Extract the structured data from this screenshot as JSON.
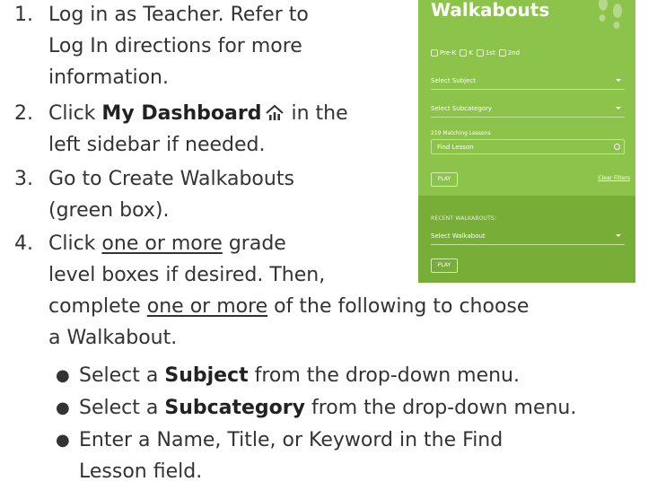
{
  "instructions": {
    "step1": {
      "number": "1.",
      "line1": "Log in as Teacher. Refer to",
      "line2": "Log In directions for more",
      "line3": "information."
    },
    "step2": {
      "number": "2.",
      "pre": "Click ",
      "bold": "My Dashboard",
      "post": " in the",
      "line2": "left sidebar if needed."
    },
    "step3": {
      "number": "3.",
      "line1": "Go to Create Walkabouts",
      "line2": "(green box)."
    },
    "step4": {
      "number": "4.",
      "l1_pre": "Click ",
      "l1_u": "one or more",
      "l1_post": " grade",
      "line2": "level boxes if desired. Then,",
      "l3_pre": "complete ",
      "l3_u": "one or more",
      "l3_post": " of the following to choose",
      "line4": "a Walkabout."
    },
    "bullets": [
      {
        "pre": "Select a ",
        "bold": "Subject",
        "post": " from the drop-down menu."
      },
      {
        "pre": "Select a ",
        "bold": "Subcategory",
        "post": " from the drop-down menu."
      },
      {
        "line1": "Enter a Name, Title, or Keyword in the Find",
        "line2": "Lesson field."
      }
    ]
  },
  "panel": {
    "title": "Walkabouts",
    "grades": [
      "Pre-K",
      "K",
      "1st",
      "2nd"
    ],
    "subject_select": "Select Subject",
    "subcategory_select": "Select Subcategory",
    "matching_count": "219 Matching Lessons",
    "find_placeholder": "Find Lesson",
    "play_label": "PLAY",
    "clear_filters": "Clear Filters",
    "recent_title": "RECENT WALKABOUTS:",
    "walkabout_select": "Select Walkabout",
    "recent_play_label": "PLAY",
    "colors": {
      "panel": "#8cc34a",
      "recent": "#78ad38",
      "text": "#ffffff"
    },
    "icons": [
      "dashboard-icon",
      "footprints-icon",
      "search-icon",
      "caret-down-icon"
    ]
  }
}
